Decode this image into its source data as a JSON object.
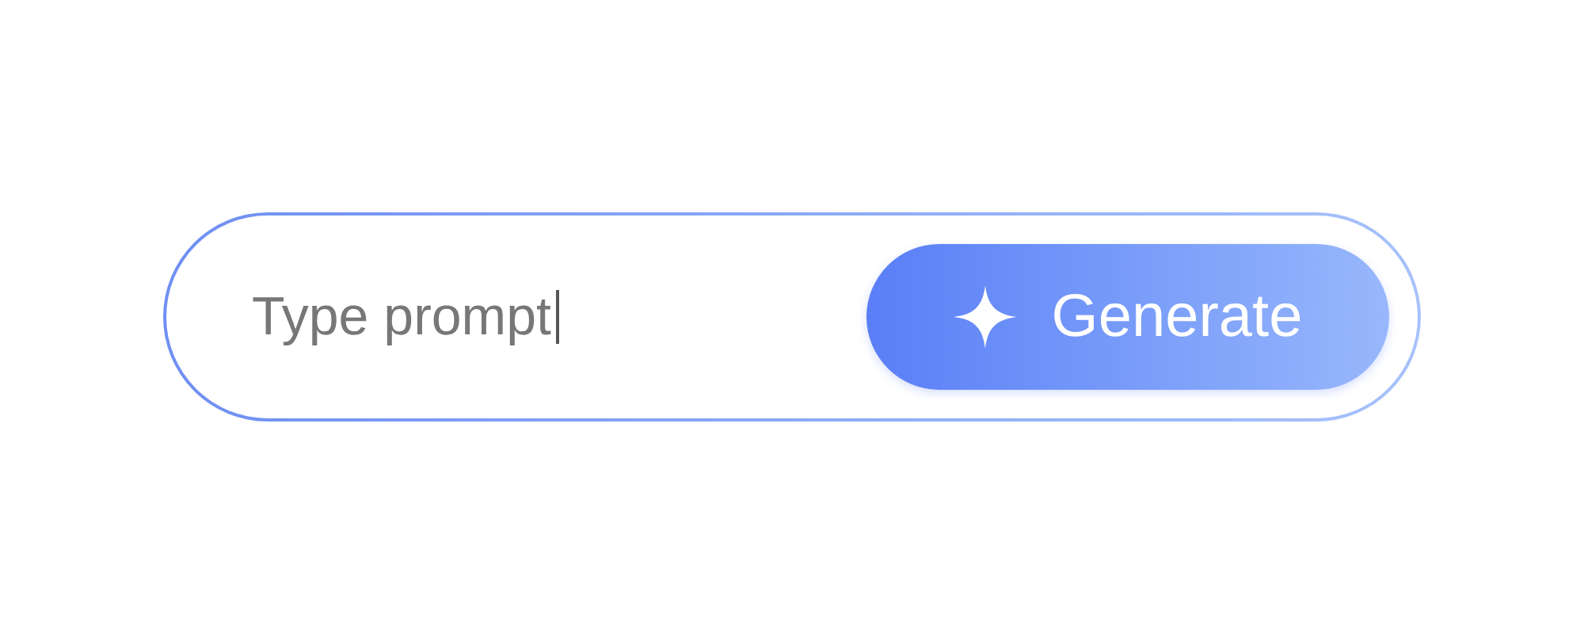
{
  "prompt_field": {
    "placeholder": "Type prompt"
  },
  "generate_button": {
    "label": "Generate"
  }
}
